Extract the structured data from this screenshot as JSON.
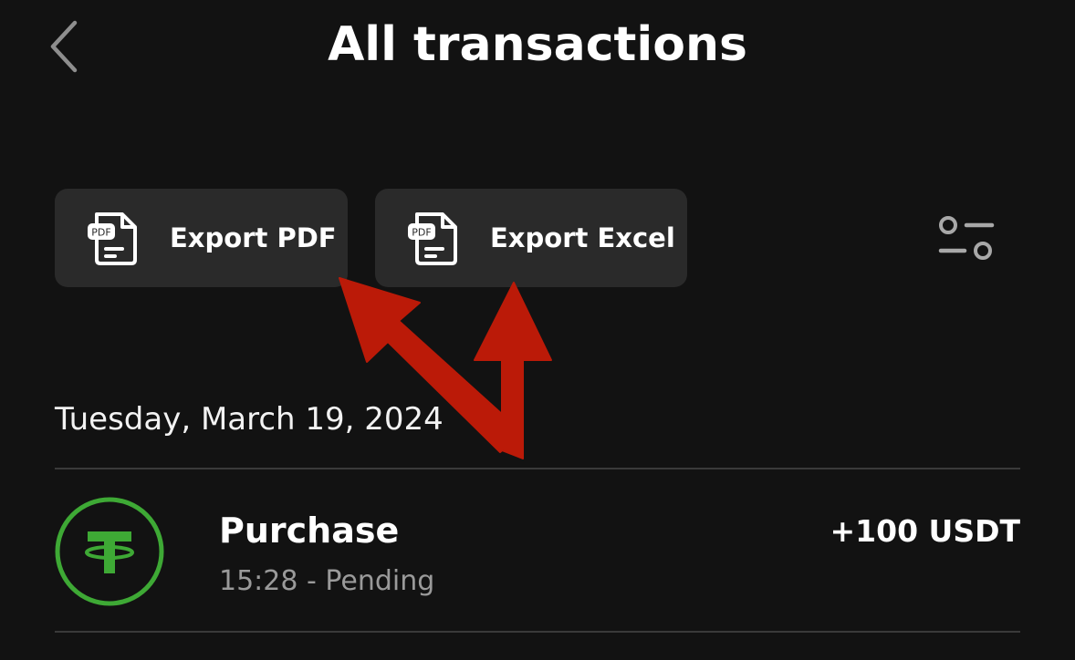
{
  "header": {
    "title": "All transactions",
    "back_icon": "chevron-left-icon"
  },
  "toolbar": {
    "export_pdf_label": "Export PDF",
    "export_excel_label": "Export Excel",
    "doc_icon_badge": "PDF",
    "filter_icon": "sliders-icon"
  },
  "transactions": {
    "groups": [
      {
        "date": "Tuesday, March 19, 2024",
        "items": [
          {
            "title": "Purchase",
            "subtitle": "15:28 - Pending",
            "amount": "+100 USDT",
            "icon": "tether-icon"
          }
        ]
      }
    ]
  },
  "annotation": {
    "arrow_color": "#bb1a08",
    "count": 2
  },
  "colors": {
    "background": "#121212",
    "button_bg": "#2a2a2a",
    "tether_green": "#3ea935",
    "muted_text": "#9a9a9a"
  }
}
